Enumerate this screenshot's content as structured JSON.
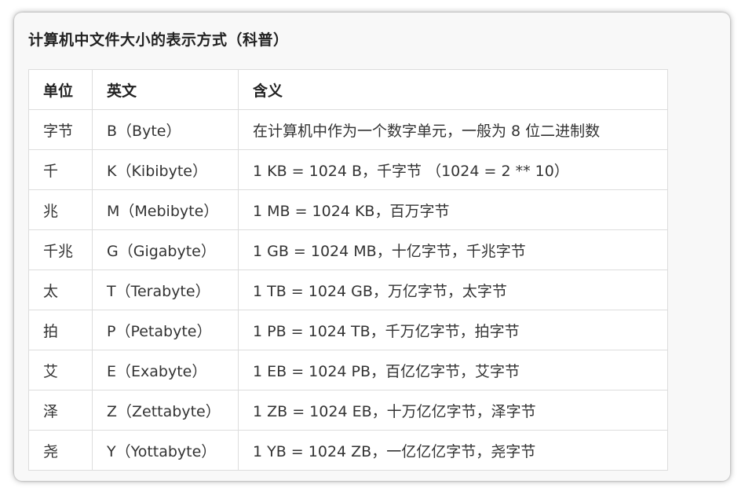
{
  "title": "计算机中文件大小的表示方式（科普）",
  "table": {
    "headers": [
      "单位",
      "英文",
      "含义"
    ],
    "rows": [
      [
        "字节",
        "B（Byte）",
        "在计算机中作为一个数字单元，一般为 8 位二进制数"
      ],
      [
        "千",
        "K（Kibibyte）",
        "1 KB = 1024 B，千字节 （1024 = 2 ** 10）"
      ],
      [
        "兆",
        "M（Mebibyte）",
        "1 MB = 1024 KB，百万字节"
      ],
      [
        "千兆",
        "G（Gigabyte）",
        "1 GB = 1024 MB，十亿字节，千兆字节"
      ],
      [
        "太",
        "T（Terabyte）",
        "1 TB = 1024 GB，万亿字节，太字节"
      ],
      [
        "拍",
        "P（Petabyte）",
        "1 PB = 1024 TB，千万亿字节，拍字节"
      ],
      [
        "艾",
        "E（Exabyte）",
        "1 EB = 1024 PB，百亿亿字节，艾字节"
      ],
      [
        "泽",
        "Z（Zettabyte）",
        "1 ZB = 1024 EB，十万亿亿字节，泽字节"
      ],
      [
        "尧",
        "Y（Yottabyte）",
        "1 YB = 1024 ZB，一亿亿亿字节，尧字节"
      ]
    ]
  }
}
